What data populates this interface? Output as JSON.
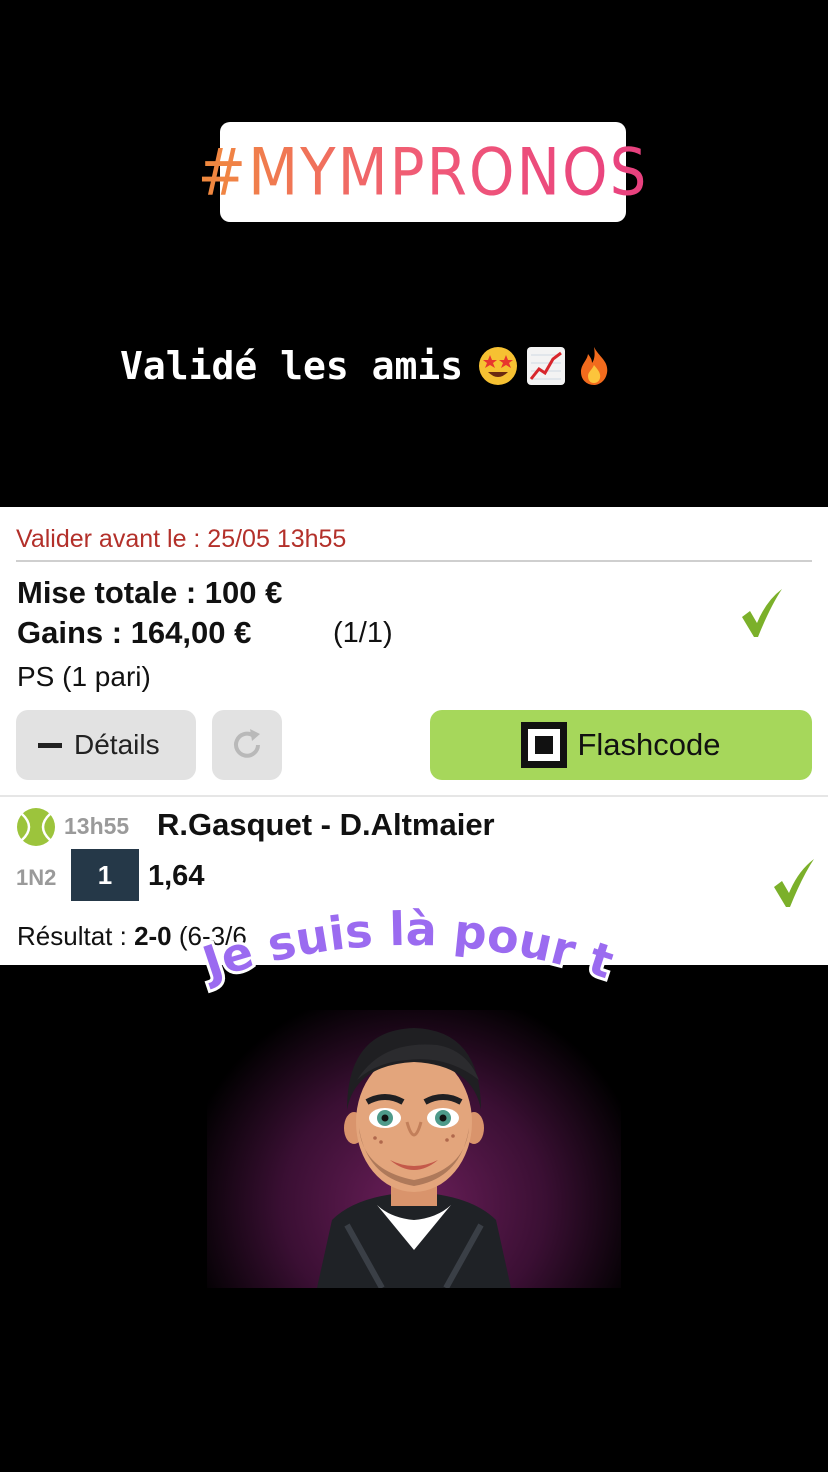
{
  "story": {
    "hashtag": "#MYMPRONOS",
    "caption": "Validé les amis",
    "caption_emojis": [
      "star-struck-emoji",
      "chart-increasing-emoji",
      "fire-emoji"
    ],
    "sticker_text": "Je suis là pour toi"
  },
  "bet_card": {
    "deadline": "Valider avant le : 25/05 13h55",
    "stake": "Mise totale : 100 €",
    "winnings": "Gains : 164,00 €",
    "count": "(1/1)",
    "bet_type": "PS (1 pari)",
    "details_label": "Détails",
    "flashcode_label": "Flashcode",
    "status_color": "#7bb02a"
  },
  "selection": {
    "time": "13h55",
    "match": "R.Gasquet - D.Altmaier",
    "market": "1N2",
    "pick": "1",
    "odds": "1,64",
    "result_label": "Résultat : ",
    "result_score": "2-0",
    "result_sets": " (6-3/6"
  }
}
